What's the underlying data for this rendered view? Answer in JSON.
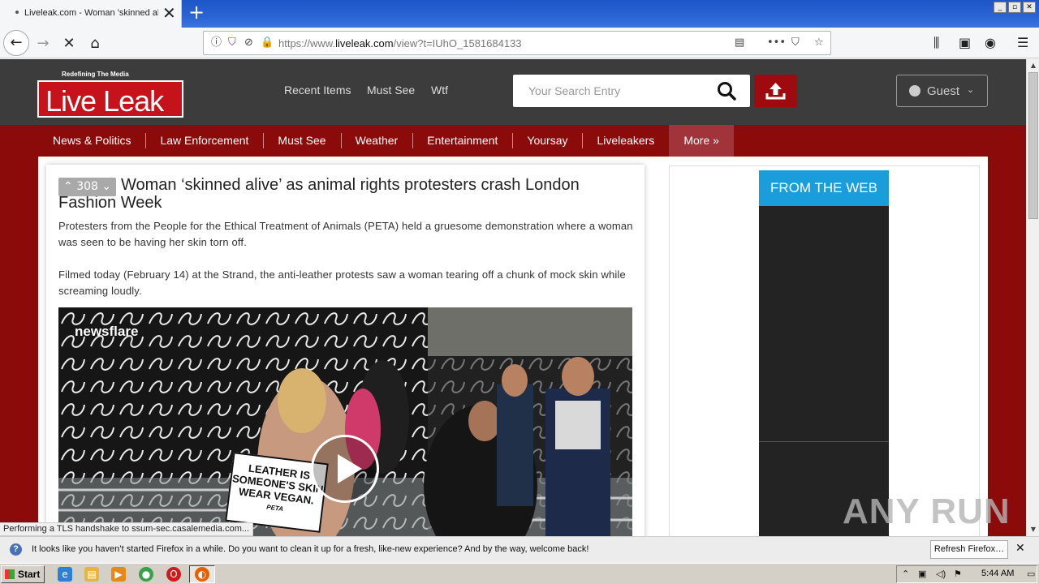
{
  "browser": {
    "tab_title": "Liveleak.com - Woman 'skinned alive'",
    "url_prefix": "https://www.",
    "url_domain": "liveleak.com",
    "url_path": "/view?t=IUhO_1581684133",
    "new_tab_glyph": "+",
    "tab_close_glyph": "✕"
  },
  "site": {
    "logo_tagline": "Redefining The Media",
    "logo_text": "Live Leak",
    "topnav": [
      "Recent Items",
      "Must See",
      "Wtf"
    ],
    "search_placeholder": "Your Search Entry",
    "user_label": "Guest",
    "categories": [
      "News & Politics",
      "Law Enforcement",
      "Must See",
      "Weather",
      "Entertainment",
      "Yoursay",
      "Liveleakers",
      "More »"
    ]
  },
  "article": {
    "votes": "308",
    "title": "Woman ‘skinned alive’ as animal rights protesters crash London Fashion Week",
    "para1": "Protesters from the People for the Ethical Treatment of Animals (PETA) held a gruesome demonstration where a woman was seen to be having her skin torn off.",
    "para2": "Filmed today (February 14) at the Strand, the anti-leather protests saw a woman tearing off a chunk of mock skin while screaming loudly.",
    "video_brand": "newsflare",
    "placard_line1": "LEATHER IS",
    "placard_line2": "SOMEONE'S SKIN",
    "placard_line3": "WEAR VEGAN.",
    "placard_brand": "PETA"
  },
  "sidebar": {
    "from_web": "FROM THE WEB"
  },
  "status_text": "Performing a TLS handshake to ssum-sec.casalemedia.com...",
  "watermark": "ANY RUN",
  "notification": {
    "text": "It looks like you haven’t started Firefox in a while. Do you want to clean it up for a fresh, like-new experience? And by the way, welcome back!",
    "button": "Refresh Firefox…"
  },
  "taskbar": {
    "start": "Start",
    "time": "5:44 AM"
  },
  "colors": {
    "site_red": "#8b0a0a",
    "header_dark": "#3c3c3c",
    "accent_blue": "#1a9ddb",
    "logo_red": "#c6131b"
  }
}
